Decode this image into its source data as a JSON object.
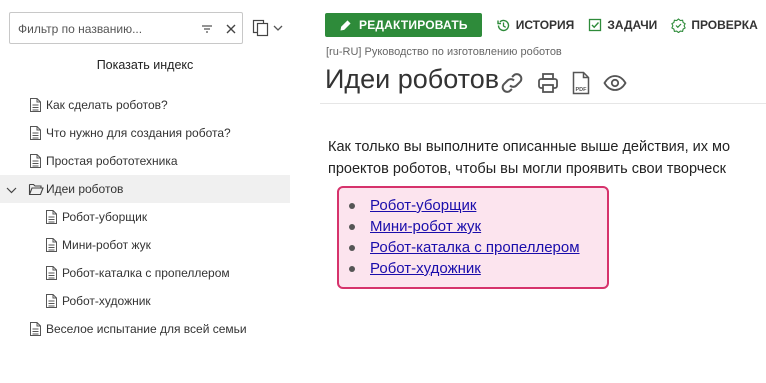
{
  "sidebar": {
    "filter_placeholder": "Фильтр по названию...",
    "show_index": "Показать индекс",
    "items": [
      {
        "label": "Как сделать роботов?"
      },
      {
        "label": "Что нужно для создания робота?"
      },
      {
        "label": "Простая робототехника"
      },
      {
        "label": "Идеи роботов"
      },
      {
        "label": "Робот-уборщик"
      },
      {
        "label": "Мини-робот жук"
      },
      {
        "label": "Робот-каталка с пропеллером"
      },
      {
        "label": "Робот-художник"
      },
      {
        "label": "Веселое испытание для всей семьи"
      }
    ]
  },
  "toolbar": {
    "edit_label": "РЕДАКТИРОВАТЬ",
    "history_label": "ИСТОРИЯ",
    "tasks_label": "ЗАДАЧИ",
    "check_label": "ПРОВЕРКА"
  },
  "page": {
    "breadcrumb": "[ru-RU] Руководство по изготовлению роботов",
    "title": "Идеи роботов",
    "paragraph_line1": "Как только вы выполните описанные выше действия, их мо",
    "paragraph_line2": "проектов роботов, чтобы вы могли проявить свои творческ",
    "links": [
      "Робот-уборщик",
      "Мини-робот жук",
      "Робот-каталка с пропеллером",
      "Робот-художник"
    ]
  },
  "colors": {
    "edit_button": "#2e8b3a",
    "accent_green": "#2e8b3a",
    "note_border": "#d6336c",
    "note_background": "#fce4ee",
    "link": "#1a0dab"
  }
}
